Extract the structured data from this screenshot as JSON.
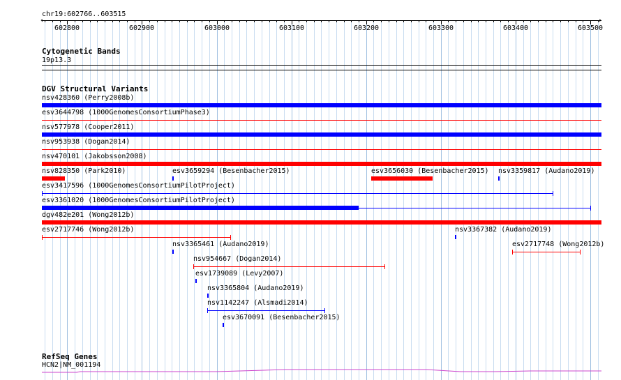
{
  "ruler": {
    "position": "chr19:602766..603515",
    "start": 602766,
    "end": 603515,
    "ticks": [
      "602800",
      "602900",
      "603000",
      "603100",
      "603200",
      "603300",
      "603400",
      "603500"
    ],
    "tick_values": [
      602800,
      602900,
      603000,
      603100,
      603200,
      603300,
      603400,
      603500
    ]
  },
  "cytoband": {
    "title": "Cytogenetic Bands",
    "band": "19p13.3"
  },
  "dgv": {
    "title": "DGV Structural Variants",
    "colors": {
      "gain": "#0000ff",
      "loss": "#ff0000"
    },
    "features": [
      {
        "label": "nsv428360 (Perry2008b)",
        "color": "#0000ff",
        "style": "thick",
        "start": 602766,
        "end": 603515
      },
      {
        "label": "esv3644798 (1000GenomesConsortiumPhase3)",
        "color": "#ff0000",
        "style": "thin",
        "start": 602766,
        "end": 603515
      },
      {
        "label": "nsv577978 (Cooper2011)",
        "color": "#0000ff",
        "style": "thick",
        "start": 602766,
        "end": 603515
      },
      {
        "label": "nsv953938 (Dogan2014)",
        "color": "#ff0000",
        "style": "thin",
        "start": 602766,
        "end": 603515
      },
      {
        "label": "nsv470101 (Jakobsson2008)",
        "color": "#ff0000",
        "style": "thick",
        "start": 602766,
        "end": 603515
      },
      {
        "label": "nsv828350 (Park2010)",
        "color": "#ff0000",
        "style": "thick",
        "start": 602766,
        "end": 602797
      },
      {
        "label": "esv3659294 (Besenbacher2015)",
        "color": "#0000ff",
        "style": "tick",
        "start": 602941,
        "end": 602942
      },
      {
        "label": "esv3656030 (Besenbacher2015)",
        "color": "#ff0000",
        "style": "thick",
        "start": 603207,
        "end": 603289
      },
      {
        "label": "nsv3359817 (Audano2019)",
        "color": "#0000ff",
        "style": "tick",
        "start": 603377,
        "end": 603378
      },
      {
        "label": "esv3417596 (1000GenomesConsortiumPilotProject)",
        "color": "#0000ff",
        "style": "line",
        "start": 602766,
        "end": 603450
      },
      {
        "label": "esv3361020 (1000GenomesConsortiumPilotProject)",
        "color": "#0000ff",
        "style": "mixed",
        "start": 602766,
        "end": 603500,
        "thick_end": 603190
      },
      {
        "label": "dgv482e201 (Wong2012b)",
        "color": "#ff0000",
        "style": "thick",
        "start": 602766,
        "end": 603515
      },
      {
        "label": "esv2717746 (Wong2012b)",
        "color": "#ff0000",
        "style": "line",
        "start": 602766,
        "end": 603018
      },
      {
        "label": "nsv3367382 (Audano2019)",
        "color": "#0000ff",
        "style": "tick",
        "start": 603319,
        "end": 603320
      },
      {
        "label": "nsv3365461 (Audano2019)",
        "color": "#0000ff",
        "style": "tick",
        "start": 602941,
        "end": 602942
      },
      {
        "label": "esv2717748 (Wong2012b)",
        "color": "#ff0000",
        "style": "line",
        "start": 603395,
        "end": 603486
      },
      {
        "label": "nsv954667 (Dogan2014)",
        "color": "#ff0000",
        "style": "line",
        "start": 602969,
        "end": 603225
      },
      {
        "label": "esv1739089 (Levy2007)",
        "color": "#0000ff",
        "style": "tick",
        "start": 602971,
        "end": 602972
      },
      {
        "label": "nsv3365804 (Audano2019)",
        "color": "#0000ff",
        "style": "tick",
        "start": 602987,
        "end": 602988
      },
      {
        "label": "nsv1142247 (Alsmadi2014)",
        "color": "#0000ff",
        "style": "line",
        "start": 602987,
        "end": 603144
      },
      {
        "label": "esv3670091 (Besenbacher2015)",
        "color": "#0000ff",
        "style": "tick",
        "start": 603008,
        "end": 603009
      }
    ]
  },
  "refseq": {
    "title": "RefSeq Genes",
    "gene": "HCN2|NM_001194",
    "color": "#cc44cc"
  }
}
